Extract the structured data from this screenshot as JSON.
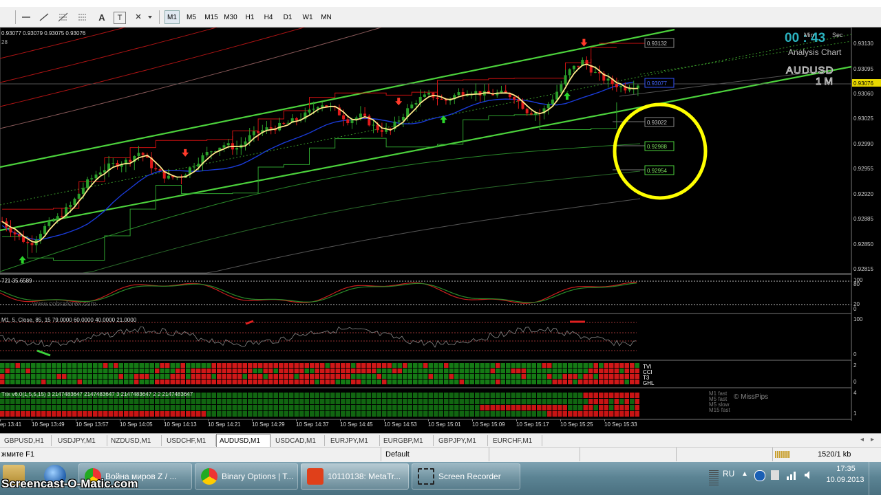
{
  "toolbar": {
    "tools": [
      "line-horizontal-icon",
      "line-trend-icon",
      "fibonacci-icon",
      "channel-icon",
      "text-icon",
      "text-label-icon",
      "arrows-icon"
    ],
    "tool_glyphs": {
      "text": "A",
      "label": "T"
    },
    "timeframes": [
      "M1",
      "M5",
      "M15",
      "M30",
      "H1",
      "H4",
      "D1",
      "W1",
      "MN"
    ],
    "active_timeframe": "M1"
  },
  "chart": {
    "ohlc_line": "0.93077 0.93079 0.93075 0.93076",
    "ohlc_line2": "28",
    "timer": "00 : 43",
    "timer_min": "Min",
    "timer_sec": "Sec",
    "analysis_label": "Analysis Chart",
    "symbol_watermark": "AUDUSD",
    "tf_watermark": "1 M",
    "price_axis": [
      "0.93130",
      "0.93095",
      "0.93060",
      "0.93025",
      "0.92990",
      "0.92955",
      "0.92920",
      "0.92885",
      "0.92850",
      "0.92815"
    ],
    "current_price": "0.93076",
    "price_boxes": [
      "0.93132",
      "0.93077",
      "0.93022",
      "0.92988",
      "0.92954"
    ],
    "stoch_label": "721 35.6589",
    "stoch_watermark": "www.cobraforex.com",
    "stoch_levels": [
      "100",
      "80",
      "20",
      "0"
    ],
    "rsi_label": "M1,  5,  Close,  85,  15 79.0000 60.0000 40.0000 21.0000",
    "rsi_levels": [
      "100",
      "0"
    ],
    "grid_labels": [
      "TVI",
      "CCI",
      "T3",
      "GHL"
    ],
    "grid_levels": [
      "2",
      "0"
    ],
    "trix_label": "Trix v6.0(1,5,5,15) 3 2147483647 2147483647 3 2147483647 2 2 2147483647",
    "trix_legend": [
      "M1 fast",
      "M5 fast",
      "M5 slow",
      "M15 fast"
    ],
    "trix_credit": "© MissPips",
    "trix_levels": [
      "4",
      "1"
    ],
    "time_axis": [
      "ep 13:41",
      "10 Sep 13:49",
      "10 Sep 13:57",
      "10 Sep 14:05",
      "10 Sep 14:13",
      "10 Sep 14:21",
      "10 Sep 14:29",
      "10 Sep 14:37",
      "10 Sep 14:45",
      "10 Sep 14:53",
      "10 Sep 15:01",
      "10 Sep 15:09",
      "10 Sep 15:17",
      "10 Sep 15:25",
      "10 Sep 15:33"
    ]
  },
  "chart_data": {
    "type": "candlestick",
    "symbol": "AUDUSD",
    "timeframe": "M1",
    "ylim": [
      0.928,
      0.9314
    ],
    "x_start": "10 Sep 13:41",
    "x_end": "10 Sep 15:35",
    "close_path": [
      0.9287,
      0.9285,
      0.92835,
      0.9286,
      0.92875,
      0.92895,
      0.92925,
      0.92945,
      0.92955,
      0.9296,
      0.92975,
      0.92948,
      0.92935,
      0.92938,
      0.92958,
      0.92975,
      0.92985,
      0.9298,
      0.92998,
      0.93008,
      0.93012,
      0.9302,
      0.9303,
      0.93048,
      0.93038,
      0.93022,
      0.93028,
      0.9301,
      0.93005,
      0.9303,
      0.93052,
      0.9306,
      0.9305,
      0.93062,
      0.93065,
      0.9306,
      0.93062,
      0.93058,
      0.93035,
      0.93032,
      0.9306,
      0.93095,
      0.9311,
      0.9309,
      0.93078,
      0.9307,
      0.93076
    ],
    "signals": [
      {
        "time": "10 Sep 13:45",
        "type": "buy"
      },
      {
        "time": "10 Sep 14:14",
        "type": "sell"
      },
      {
        "time": "10 Sep 14:52",
        "type": "sell"
      },
      {
        "time": "10 Sep 15:00",
        "type": "buy"
      },
      {
        "time": "10 Sep 15:22",
        "type": "buy"
      },
      {
        "time": "10 Sep 15:25",
        "type": "sell"
      }
    ]
  },
  "tabs": [
    "GBPUSD,H1",
    "USDJPY,M1",
    "NZDUSD,M1",
    "USDCHF,M1",
    "AUDUSD,M1",
    "USDCAD,M1",
    "EURJPY,M1",
    "EURGBP,M1",
    "GBPJPY,M1",
    "EURCHF,M1"
  ],
  "active_tab": "AUDUSD,M1",
  "status": {
    "help": "жмите F1",
    "profile": "Default",
    "traffic": "1520/1 kb"
  },
  "taskbar": {
    "buttons": [
      "Война миров Z / ...",
      "Binary Options | T...",
      "10110138: MetaTr...",
      "Screen Recorder"
    ],
    "lang": "RU",
    "time": "17:35",
    "date": "10.09.2013",
    "watermark": "Screencast-O-Matic.com"
  }
}
